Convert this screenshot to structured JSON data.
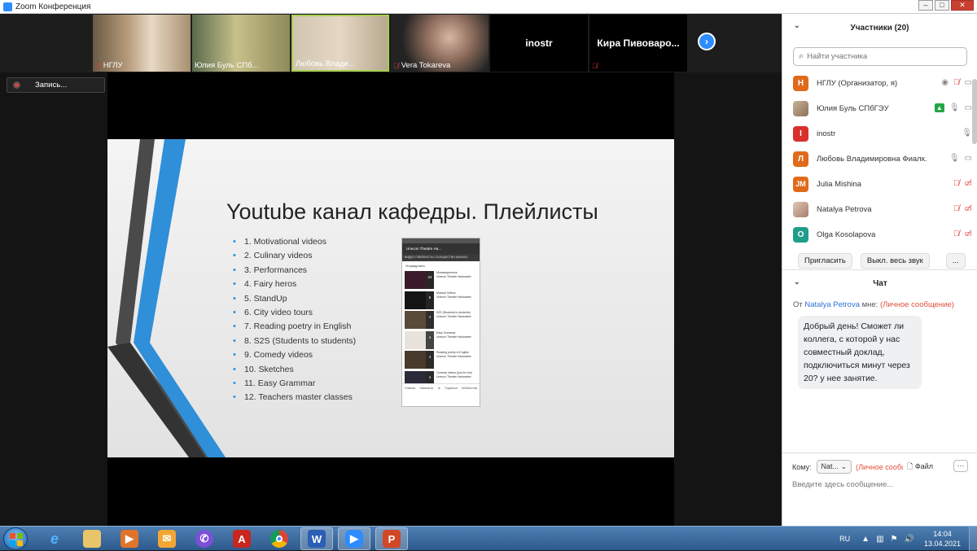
{
  "window": {
    "title": "Zoom Конференция"
  },
  "video_strip": {
    "tiles": [
      {
        "name": "НГЛУ",
        "muted": true
      },
      {
        "name": "Юлия Буль СПб...",
        "muted": false
      },
      {
        "name": "Любовь Влади...",
        "muted": false
      },
      {
        "name": "Vera Tokareva",
        "muted": true
      },
      {
        "name": "inostr",
        "muted": false
      },
      {
        "name": "Кира  Пивоваро...",
        "muted": true
      }
    ]
  },
  "recording": {
    "label": "Запись..."
  },
  "slide": {
    "title": "Youtube канал кафедры. Плейлисты",
    "items": [
      "1. Motivational videos",
      "2. Culinary videos",
      "3. Performances",
      "4. Fairy heros",
      "5. StandUp",
      "6. City video tours",
      "7. Reading poetry in English",
      "8. S2S (Students to students)",
      "9. Comedy videos",
      "10. Sketches",
      "11.  Easy Grammar",
      "12. Teachers master classes"
    ],
    "phone": {
      "header": "Unecon Theatre Ha...",
      "tabs": "ВИДЕО   ПЛЕЙЛИСТЫ   СООБЩЕСТВО   КАНАЛЫ",
      "sort": "Упорядочить",
      "rows": [
        {
          "count": "24",
          "title": "Мотивационное",
          "sub": "Unecon Theatre Hacksaber"
        },
        {
          "count": "8",
          "title": "Musical Videos",
          "sub": "Unecon Theatre Hacksaber"
        },
        {
          "count": "4",
          "title": "S2S (Students to students)",
          "sub": "Unecon Theatre Hacksaber"
        },
        {
          "count": "4",
          "title": "Easy Grammar",
          "sub": "Unecon Theatre Hacksaber"
        },
        {
          "count": "4",
          "title": "Reading poetry in English",
          "sub": "Unecon Theatre Hacksaber"
        },
        {
          "count": "4",
          "title": "Comedy videos (just for fun)",
          "sub": "Unecon Theatre Hacksaber"
        }
      ],
      "nav": [
        "Главная",
        "Навигатор",
        "",
        "Подписки",
        "Библиотека"
      ]
    }
  },
  "participants": {
    "header": "Участники (20)",
    "search_placeholder": "Найти участника",
    "list": [
      {
        "initial": "Н",
        "color": "#e06a1b",
        "name": "НГЛУ (Организатор, я)"
      },
      {
        "initial": "",
        "color": "",
        "name": "Юлия Буль СПбГЭУ"
      },
      {
        "initial": "I",
        "color": "#d9302b",
        "name": "inostr"
      },
      {
        "initial": "Л",
        "color": "#e06a1b",
        "name": "Любовь Владимировна Фиалк..."
      },
      {
        "initial": "JM",
        "color": "#e06a1b",
        "name": "Julia Mishina"
      },
      {
        "initial": "",
        "color": "",
        "name": "Natalya Petrova"
      },
      {
        "initial": "O",
        "color": "#1f9d8b",
        "name": "Olga Kosolapova"
      }
    ],
    "invite_label": "Пригласить",
    "mute_all_label": "Выкл. весь звук",
    "more_label": "..."
  },
  "chat": {
    "header": "Чат",
    "from_prefix": "От",
    "from_name": "Natalya Petrova",
    "from_suffix": "мне:",
    "private_note": "(Личное сообщение)",
    "message": "Добрый день! Сможет ли коллега, с которой у нас совместный доклад, подключиться минут через 20? у нее занятие.",
    "to_label": "Кому:",
    "to_value": "Nat...",
    "to_private": "(Личное сообщ",
    "file_label": "Файл",
    "more_label": "···",
    "input_placeholder": "Введите здесь сообщение..."
  },
  "taskbar": {
    "lang": "RU",
    "time": "14:04",
    "date": "13.04.2021"
  }
}
